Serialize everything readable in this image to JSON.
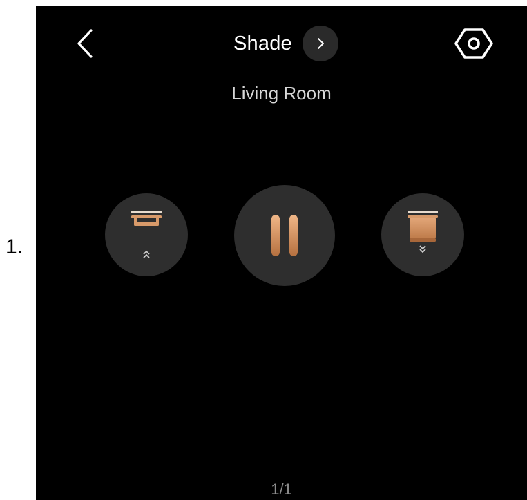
{
  "list_marker": "1.",
  "header": {
    "back_icon": "chevron-left-icon",
    "title": "Shade",
    "next_icon": "chevron-right-icon",
    "settings_icon": "hexagon-gear-icon"
  },
  "room_name": "Living Room",
  "controls": {
    "open_icon": "shade-open-icon",
    "pause_icon": "pause-icon",
    "close_icon": "shade-close-icon"
  },
  "pagination": "1/1",
  "colors": {
    "background": "#000000",
    "button_bg": "#2e2e2e",
    "accent": "#d89a6a",
    "accent_dark": "#b5703f",
    "text_primary": "#ffffff",
    "text_secondary": "#d7d7d7",
    "text_muted": "#8c8c8c"
  }
}
